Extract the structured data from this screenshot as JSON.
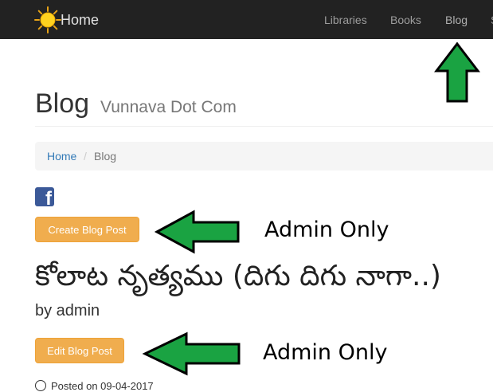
{
  "navbar": {
    "brand": "Home",
    "links": [
      "Libraries",
      "Books",
      "Blog"
    ],
    "cut_link": "S"
  },
  "header": {
    "title": "Blog",
    "subtitle": "Vunnava Dot Com"
  },
  "breadcrumb": {
    "home": "Home",
    "separator": "/",
    "current": "Blog"
  },
  "social": {
    "icon": "facebook-icon",
    "glyph": "f"
  },
  "buttons": {
    "create": "Create Blog Post",
    "edit": "Edit Blog Post"
  },
  "post": {
    "title": "కోలాట నృత్యము (దిగు దిగు నాగా..)",
    "byline": "by admin",
    "posted": "Posted on 09-04-2017"
  },
  "annotations": {
    "admin_label": "Admin Only",
    "arrow_color": "#1aa342"
  },
  "colors": {
    "navbar_bg": "#222222",
    "warning_button": "#f0ad4e",
    "link": "#337ab7",
    "facebook": "#3b5998"
  }
}
